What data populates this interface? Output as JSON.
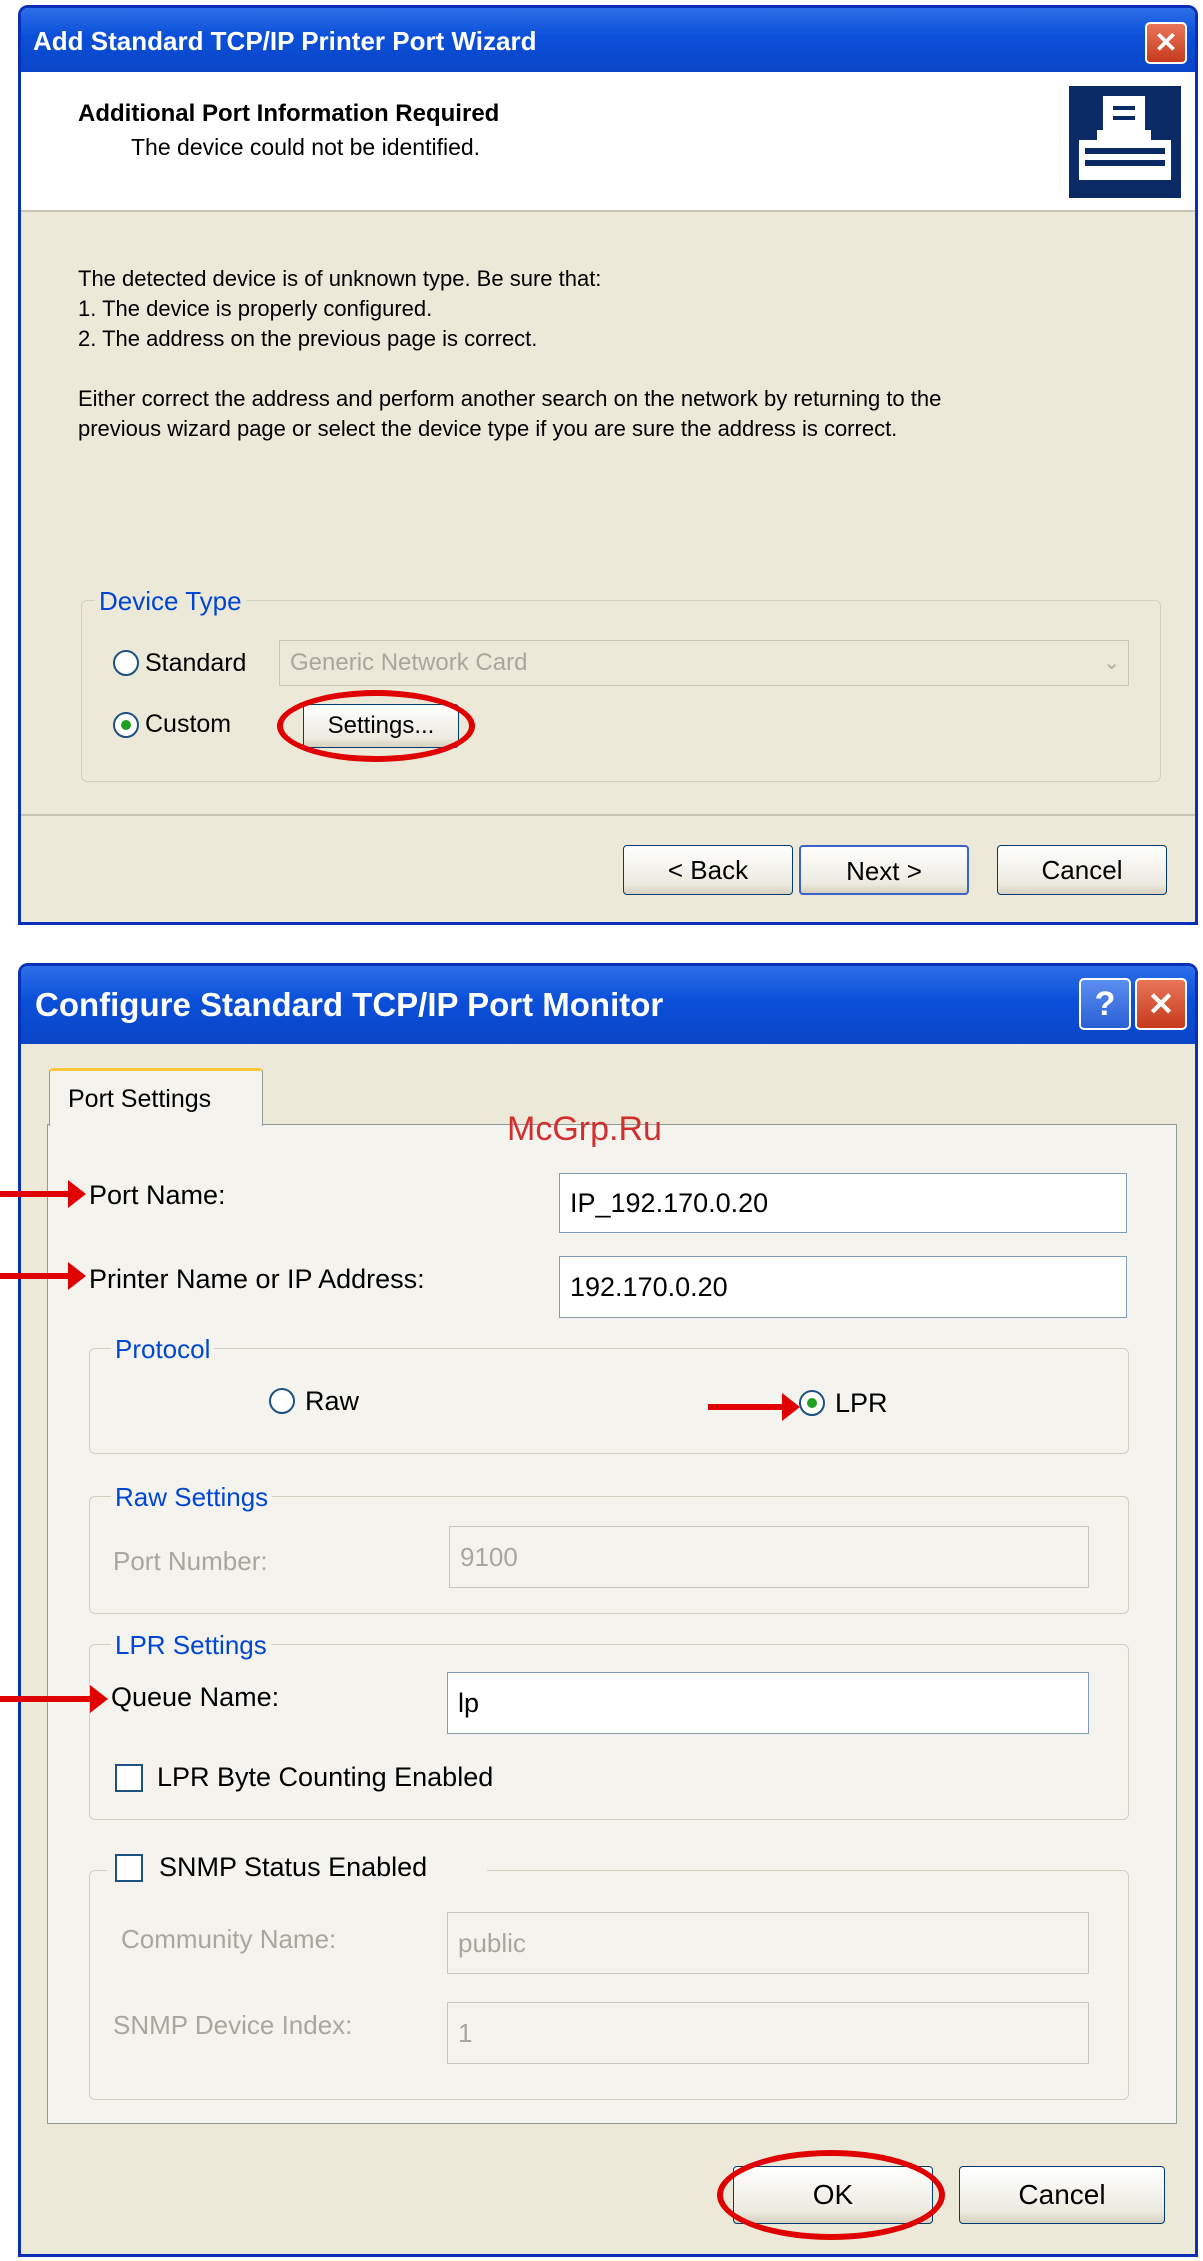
{
  "wizard": {
    "title": "Add Standard TCP/IP Printer Port Wizard",
    "header_title": "Additional Port Information Required",
    "header_subtitle": "The device could not be identified.",
    "line1": "The detected device is of unknown type.  Be sure that:",
    "line2": "1. The device is properly configured.",
    "line3": "2.  The address on the previous page is correct.",
    "para2a": "Either correct the address and perform another search on the network by returning to the",
    "para2b": "previous wizard page or select the device type if you are sure the address is correct.",
    "device_type_label": "Device Type",
    "standard_label": "Standard",
    "standard_value": "Generic Network Card",
    "custom_label": "Custom",
    "standard_selected": false,
    "custom_selected": true,
    "settings_button": "Settings...",
    "back_button": "< Back",
    "next_button": "Next >",
    "cancel_button": "Cancel"
  },
  "port_monitor": {
    "title": "Configure Standard TCP/IP Port Monitor",
    "help_glyph": "?",
    "tab_label": "Port Settings",
    "port_name_label": "Port Name:",
    "port_name_value": "IP_192.170.0.20",
    "printer_name_label": "Printer Name or IP Address:",
    "printer_name_value": "192.170.0.20",
    "protocol_label": "Protocol",
    "raw_label": "Raw",
    "lpr_label": "LPR",
    "raw_selected": false,
    "lpr_selected": true,
    "raw_settings_label": "Raw Settings",
    "port_number_label": "Port Number:",
    "port_number_value": "9100",
    "lpr_settings_label": "LPR Settings",
    "queue_name_label": "Queue Name:",
    "queue_name_value": "lp",
    "byte_counting_label": "LPR Byte Counting Enabled",
    "byte_counting_checked": false,
    "snmp_label": "SNMP Status Enabled",
    "snmp_checked": false,
    "community_name_label": "Community Name:",
    "community_name_value": "public",
    "snmp_index_label": "SNMP Device Index:",
    "snmp_index_value": "1",
    "ok_button": "OK",
    "cancel_button": "Cancel"
  },
  "watermark": "McGrp.Ru",
  "colors": {
    "title_blue": "#0b4fd9",
    "dialog_bg": "#ece9d8",
    "annotation_red": "#e00000",
    "legend_blue": "#0046d5"
  }
}
